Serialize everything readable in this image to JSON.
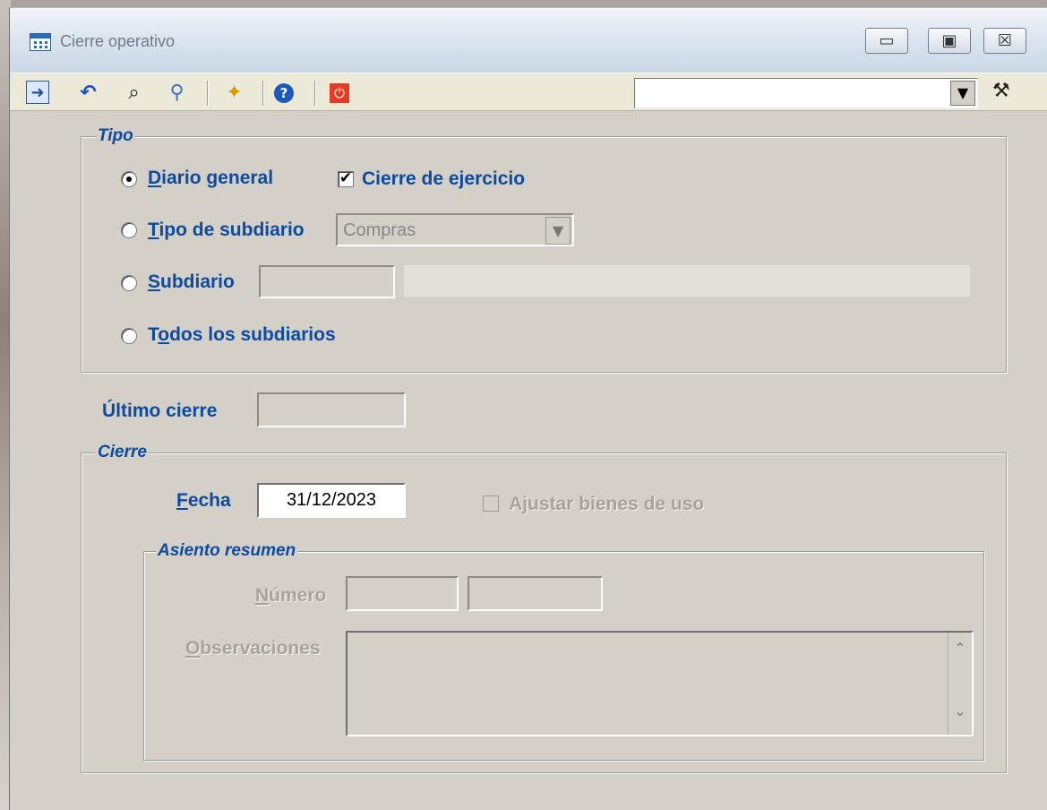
{
  "window": {
    "title": "Cierre operativo",
    "minimize_symbol": "▭",
    "maximize_symbol": "▣",
    "close_symbol": "☒"
  },
  "toolbar": {
    "search_value": "",
    "buttons": [
      {
        "name": "enter-icon",
        "symbol": "➜"
      },
      {
        "name": "undo-icon",
        "symbol": "↶"
      },
      {
        "name": "find-icon",
        "symbol": "⌕"
      },
      {
        "name": "magnifier-icon",
        "symbol": "⚲"
      },
      {
        "name": "new-record-icon",
        "symbol": "✦"
      },
      {
        "name": "help-icon",
        "symbol": "?"
      },
      {
        "name": "power-icon",
        "symbol": "⏻"
      }
    ],
    "dropdown_symbol": "▼",
    "wand_symbol": "⚒"
  },
  "tipo": {
    "legend": "Tipo",
    "options": {
      "diario_general_prefix": "",
      "diario_general_hotkey": "D",
      "diario_general_rest": "iario general",
      "tipo_subdiario_hotkey": "T",
      "tipo_subdiario_rest": "ipo de subdiario",
      "subdiario_hotkey": "S",
      "subdiario_rest": "ubdiario",
      "todos_t": "T",
      "todos_hotkey": "o",
      "todos_rest": "dos los subdiarios"
    },
    "cierre_ejercicio": "Cierre de ejercicio",
    "check_mark": "✔",
    "subdiario_type_value": "Compras",
    "select_arrow": "▼"
  },
  "ultimo_cierre": {
    "label": "Último cierre",
    "value": ""
  },
  "cierre": {
    "legend": "Cierre",
    "fecha_hotkey": "F",
    "fecha_rest": "echa",
    "fecha_value": "31/12/2023",
    "ajustar_a": "A",
    "ajustar_hotkey": "j",
    "ajustar_rest": "ustar bienes de uso"
  },
  "asiento_resumen": {
    "legend": "Asiento resumen",
    "numero_hotkey": "N",
    "numero_rest": "úmero",
    "observaciones_hotkey": "O",
    "observaciones_rest": "bservaciones",
    "numero_value_1": "",
    "numero_value_2": "",
    "scroll_up": "⌃",
    "scroll_down": "⌄"
  }
}
